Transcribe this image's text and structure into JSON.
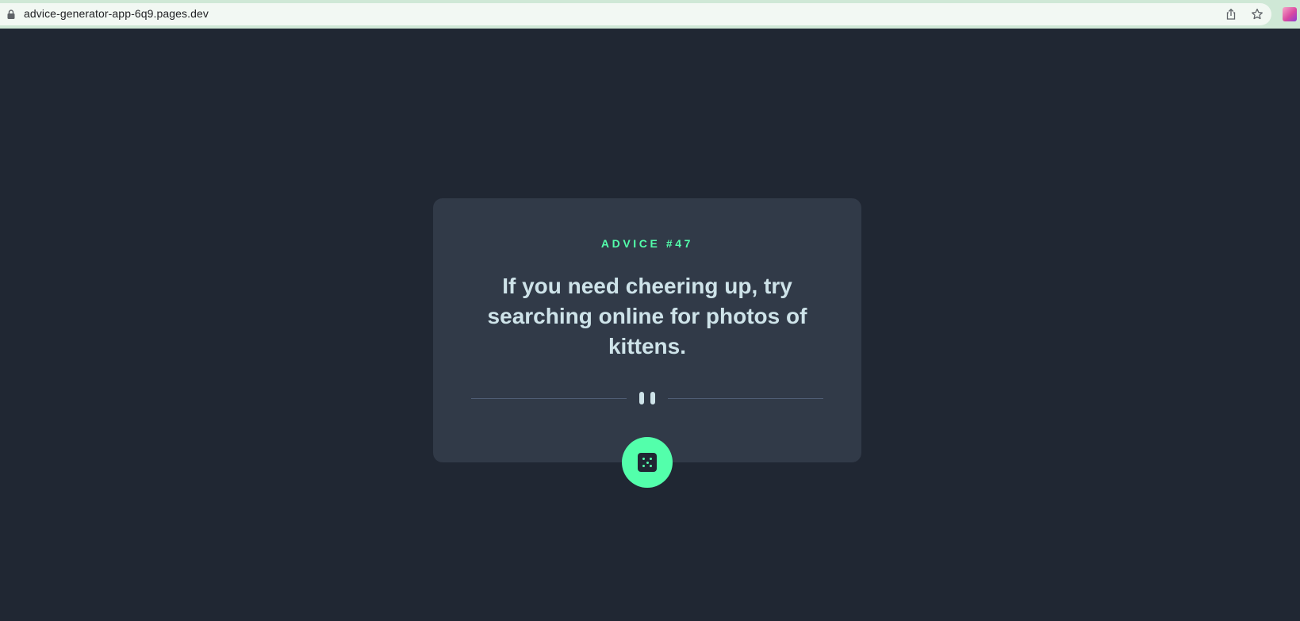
{
  "browser": {
    "url": "advice-generator-app-6q9.pages.dev",
    "icons": [
      "lock-icon",
      "share-icon",
      "star-icon",
      "extension-icon"
    ]
  },
  "advice": {
    "id_label": "ADVICE #47",
    "text": "If you need cheering up, try searching online for photos of kittens."
  },
  "controls": {
    "dice_icon": "dice-icon"
  },
  "colors": {
    "background": "#202733",
    "card": "#313a48",
    "accent": "#53ffab",
    "quote_text": "#cee3e9",
    "divider": "#4f5d74"
  }
}
